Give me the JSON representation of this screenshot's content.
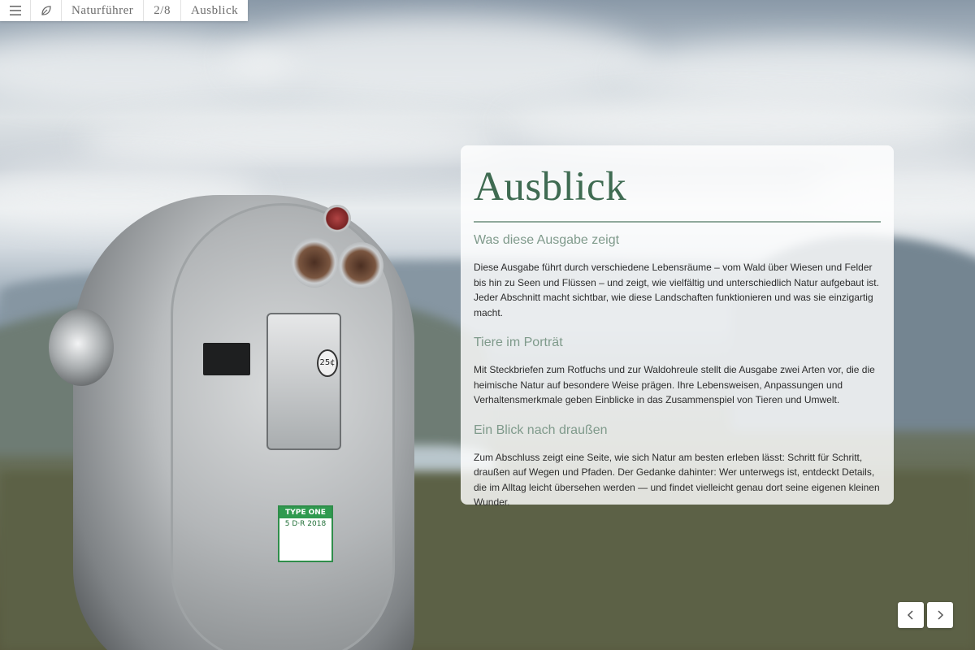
{
  "topbar": {
    "menu_icon": "hamburger-menu-icon",
    "logo_icon": "leaf-icon",
    "title": "Naturführer",
    "page_counter": "2/8",
    "section": "Ausblick"
  },
  "card": {
    "heading": "Ausblick",
    "sections": [
      {
        "title": "Was diese Ausgabe zeigt",
        "text": "Diese Ausgabe führt durch verschiedene Lebensräume – vom Wald über Wiesen und Felder bis hin zu Seen und Flüssen – und zeigt, wie vielfältig und unterschiedlich Natur aufgebaut ist. Jeder Abschnitt macht sichtbar, wie diese Landschaften funktionieren und was sie einzigartig macht."
      },
      {
        "title": "Tiere im Porträt",
        "text": "Mit Steckbriefen zum Rotfuchs und zur Waldohreule stellt die Ausgabe zwei Arten vor, die die heimische Natur auf besondere Weise prägen. Ihre Lebensweisen, Anpassungen und Verhaltensmerkmale geben Einblicke in das Zusammenspiel von Tieren und Umwelt."
      },
      {
        "title": "Ein Blick nach draußen",
        "text": "Zum Abschluss zeigt eine Seite, wie sich Natur am besten erleben lässt: Schritt für Schritt, draußen auf Wegen und Pfaden. Der Gedanke dahinter: Wer unterwegs ist, entdeckt Details, die im Alltag leicht übersehen werden — und findet vielleicht genau dort seine eigenen kleinen Wunder."
      }
    ]
  },
  "pager": {
    "prev_icon": "chevron-left-icon",
    "next_icon": "chevron-right-icon"
  },
  "image": {
    "sticker_top": "TYPE ONE",
    "sticker_code": "5 D·R 2018",
    "coin_label": "25¢"
  },
  "colors": {
    "accent": "#3f6b52",
    "subheading": "#7f9a8b",
    "rule": "#8fa89b"
  }
}
